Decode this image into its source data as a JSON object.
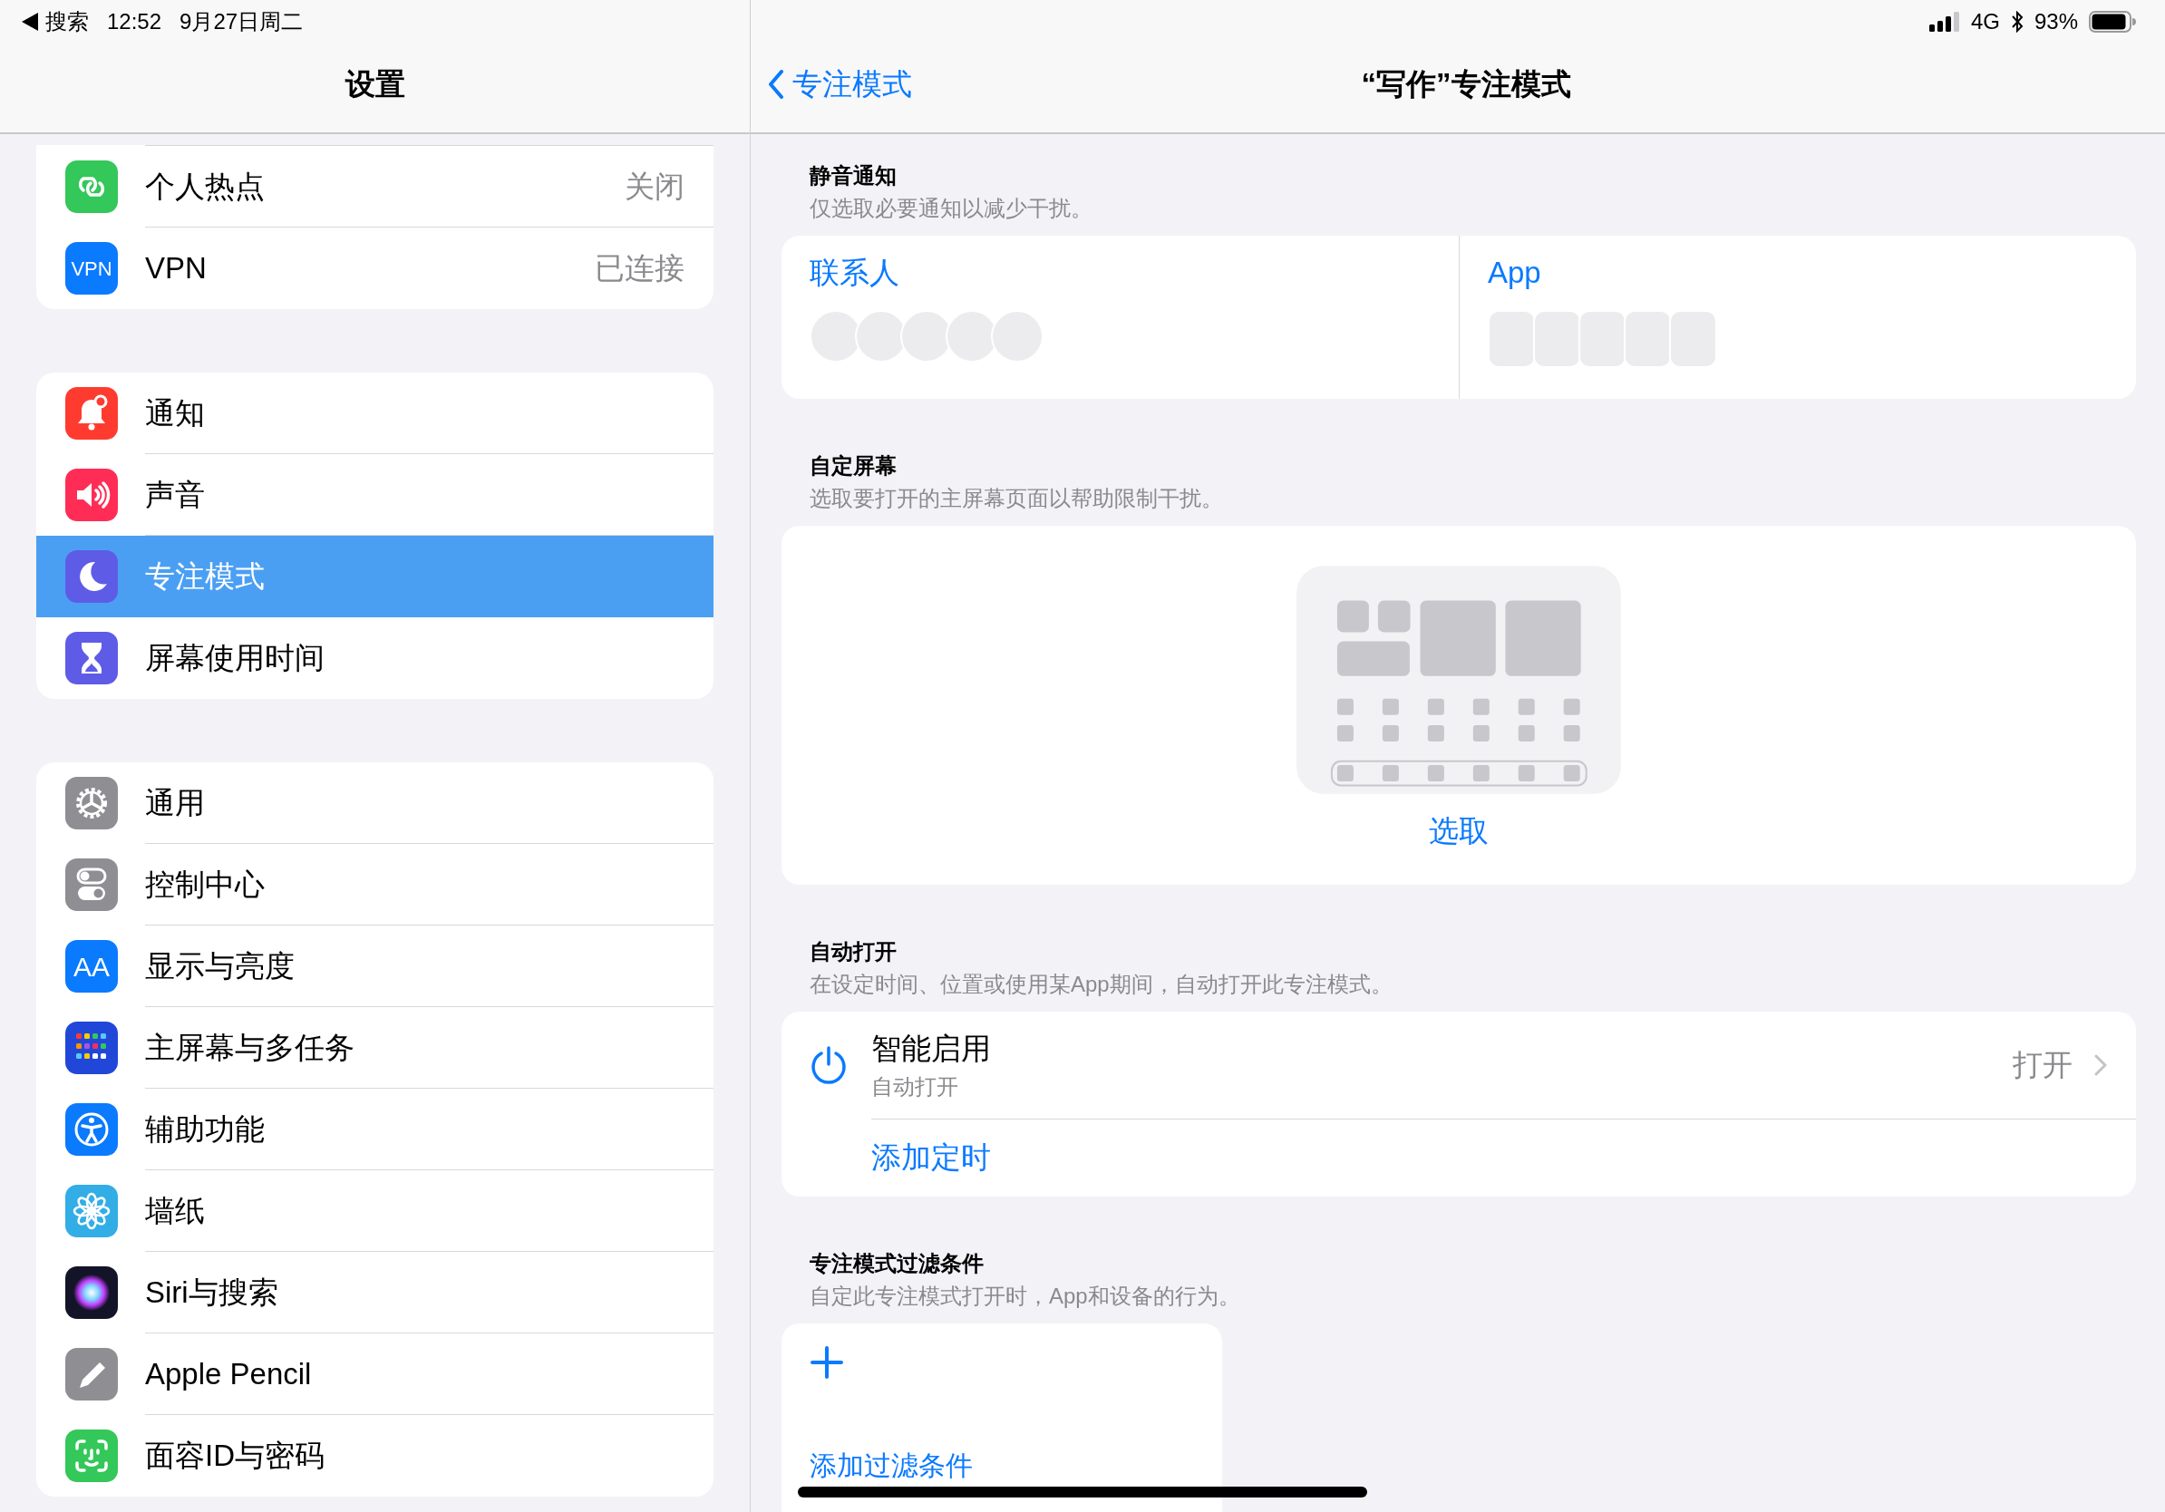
{
  "status_bar": {
    "back_app": "搜索",
    "time": "12:52",
    "date": "9月27日周二",
    "network": "4G",
    "battery": "93%"
  },
  "sidebar": {
    "title": "设置",
    "groups": [
      {
        "items": [
          {
            "kind": "hotspot",
            "label": "个人热点",
            "value": "关闭",
            "selected": false
          },
          {
            "kind": "vpn",
            "icon_text": "VPN",
            "label": "VPN",
            "value": "已连接",
            "selected": false
          }
        ]
      },
      {
        "items": [
          {
            "kind": "notifications",
            "label": "通知",
            "selected": false
          },
          {
            "kind": "sound",
            "label": "声音",
            "selected": false
          },
          {
            "kind": "focus",
            "label": "专注模式",
            "selected": true
          },
          {
            "kind": "screentime",
            "label": "屏幕使用时间",
            "selected": false
          }
        ]
      },
      {
        "items": [
          {
            "kind": "general",
            "label": "通用",
            "selected": false
          },
          {
            "kind": "control",
            "label": "控制中心",
            "selected": false
          },
          {
            "kind": "display",
            "icon_text": "AA",
            "label": "显示与亮度",
            "selected": false
          },
          {
            "kind": "home",
            "label": "主屏幕与多任务",
            "selected": false
          },
          {
            "kind": "accessibility",
            "label": "辅助功能",
            "selected": false
          },
          {
            "kind": "wallpaper",
            "label": "墙纸",
            "selected": false
          },
          {
            "kind": "siri",
            "label": "Siri与搜索",
            "selected": false
          },
          {
            "kind": "pencil",
            "label": "Apple Pencil",
            "selected": false
          },
          {
            "kind": "faceid",
            "label": "面容ID与密码",
            "selected": false
          }
        ]
      }
    ]
  },
  "nav": {
    "back": "专注模式",
    "title": "“写作”专注模式"
  },
  "sections": [
    {
      "kind": "silence",
      "header": "静音通知",
      "subtitle": "仅选取必要通知以减少干扰。",
      "columns": [
        {
          "kind": "avatars",
          "label": "联系人"
        },
        {
          "kind": "apps",
          "label": "App"
        }
      ]
    },
    {
      "kind": "screen",
      "header": "自定屏幕",
      "subtitle": "选取要打开的主屏幕页面以帮助限制干扰。",
      "action": "选取"
    },
    {
      "kind": "automation",
      "header": "自动打开",
      "subtitle": "在设定时间、位置或使用某App期间，自动打开此专注模式。",
      "rows": [
        {
          "title": "智能启用",
          "detail": "自动打开",
          "value": "打开"
        }
      ],
      "add": "添加定时"
    },
    {
      "kind": "filters",
      "header": "专注模式过滤条件",
      "subtitle": "自定此专注模式打开时，App和设备的行为。",
      "add": "添加过滤条件"
    }
  ]
}
